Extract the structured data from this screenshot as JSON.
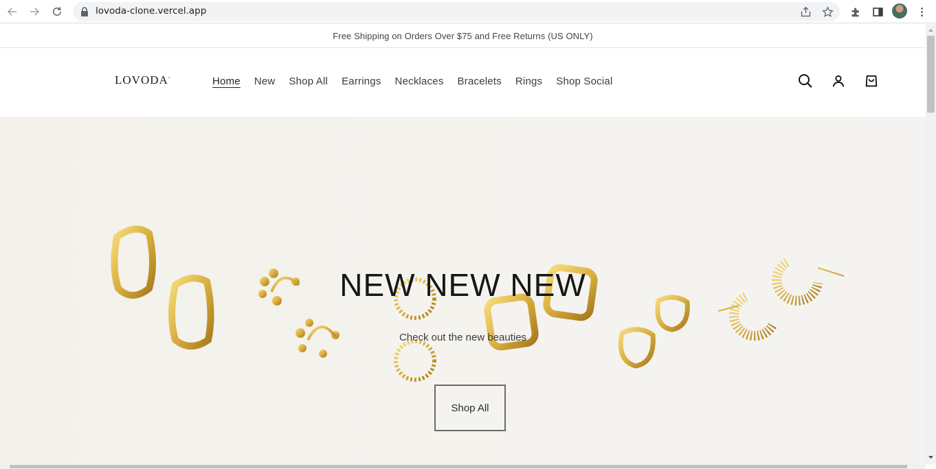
{
  "browser": {
    "url": "lovoda-clone.vercel.app"
  },
  "site": {
    "announcement": "Free Shipping on Orders Over $75 and Free Returns (US ONLY)",
    "logo": "LOVODA",
    "nav": [
      "Home",
      "New",
      "Shop All",
      "Earrings",
      "Necklaces",
      "Bracelets",
      "Rings",
      "Shop Social"
    ],
    "active_nav": "Home"
  },
  "hero": {
    "title": "NEW NEW NEW",
    "subtitle": "Check out the new beauties",
    "button": "Shop All"
  },
  "colors": {
    "accent_gold": "#d9ae3f",
    "text_dark": "#161616",
    "hero_bg": "#f4f2ed"
  },
  "icons": [
    "back-arrow-icon",
    "forward-arrow-icon",
    "reload-icon",
    "lock-icon",
    "share-icon",
    "star-icon",
    "extensions-icon",
    "side-panel-icon",
    "menu-icon",
    "search-icon",
    "account-icon",
    "cart-icon"
  ]
}
